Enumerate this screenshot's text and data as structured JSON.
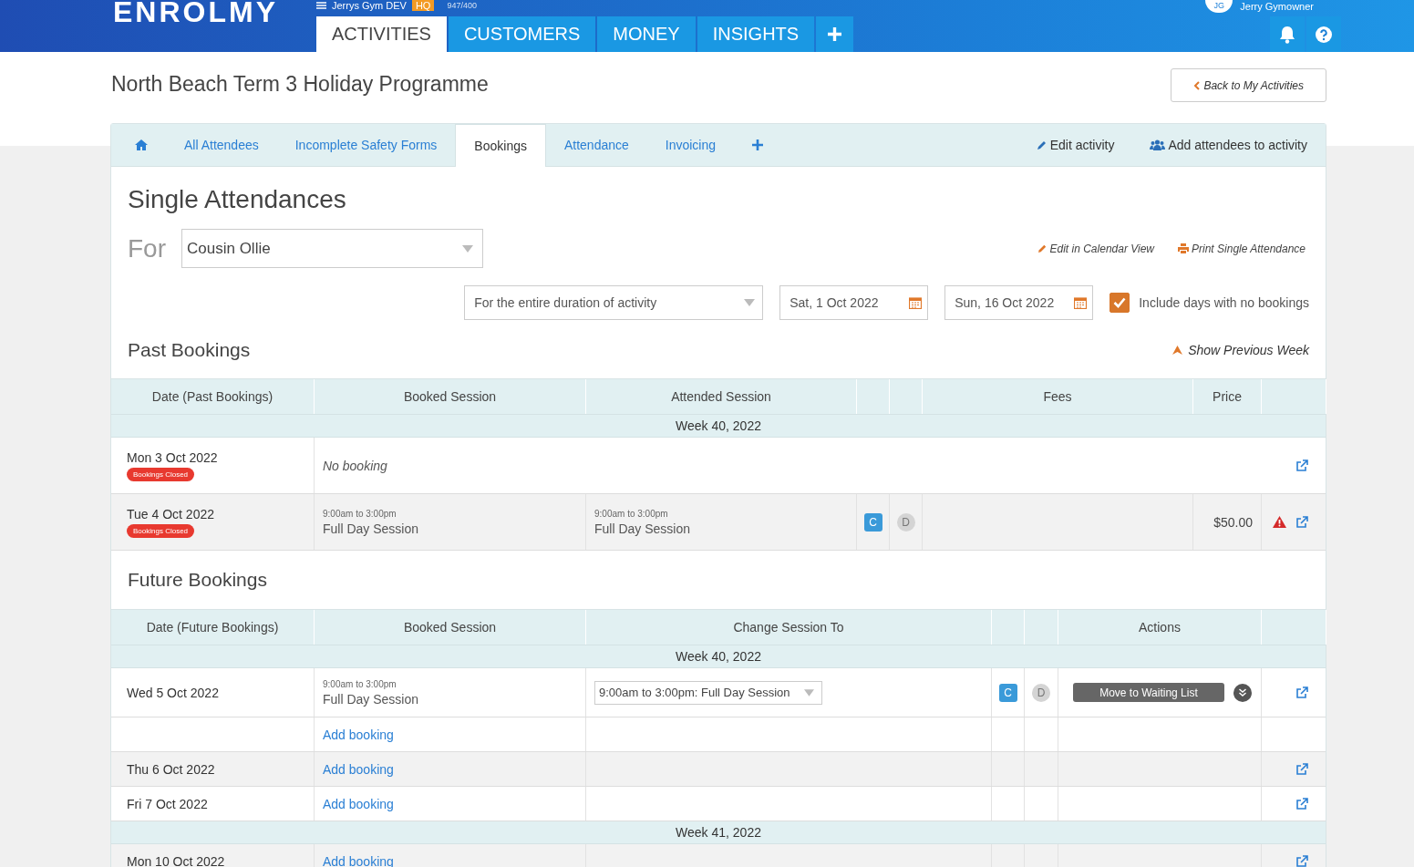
{
  "header": {
    "logo": "ENROLMY",
    "account": "Jerrys Gym DEV",
    "account_badge": "HQ",
    "count": "947/400",
    "user_initials": "JG",
    "user_name": "Jerry Gymowner",
    "nav": [
      {
        "label": "ACTIVITIES",
        "selected": true
      },
      {
        "label": "CUSTOMERS",
        "selected": false
      },
      {
        "label": "MONEY",
        "selected": false
      },
      {
        "label": "INSIGHTS",
        "selected": false
      }
    ]
  },
  "page_title": "North Beach Term 3 Holiday Programme",
  "back_button": "Back to My Activities",
  "tabs": [
    {
      "kind": "home",
      "selected": false
    },
    {
      "kind": "text",
      "label": "All Attendees",
      "selected": false
    },
    {
      "kind": "text",
      "label": "Incomplete Safety Forms",
      "selected": false
    },
    {
      "kind": "text",
      "label": "Bookings",
      "selected": true
    },
    {
      "kind": "text",
      "label": "Attendance",
      "selected": false
    },
    {
      "kind": "text",
      "label": "Invoicing",
      "selected": false
    },
    {
      "kind": "add",
      "selected": false
    }
  ],
  "tab_actions": [
    {
      "kind": "edit",
      "label": "Edit activity"
    },
    {
      "kind": "users",
      "label": "Add attendees to activity"
    }
  ],
  "section_title": "Single Attendances",
  "for_label": "For",
  "attendee_select": "Cousin Ollie",
  "links": [
    {
      "kind": "edit",
      "label": "Edit in Calendar View"
    },
    {
      "kind": "print",
      "label": "Print Single Attendance"
    }
  ],
  "duration_select": "For the entire duration of activity",
  "start_date": "Sat, 1 Oct 2022",
  "end_date": "Sun, 16 Oct 2022",
  "include_empty": {
    "label": "Include days with no bookings",
    "checked": true
  },
  "past": {
    "title": "Past Bookings",
    "toggle": "Show Previous Week",
    "columns": [
      "Date (Past Bookings)",
      "Booked Session",
      "Attended Session",
      "",
      "",
      "Fees",
      "Price",
      ""
    ],
    "rows": [
      {
        "kind": "week",
        "label": "Week 40, 2022"
      },
      {
        "kind": "day",
        "shaded": false,
        "date": "Mon 3 Oct 2022",
        "badge": "Bookings Closed",
        "no_booking": "No booking"
      },
      {
        "kind": "day",
        "shaded": true,
        "date": "Tue 4 Oct 2022",
        "badge": "Bookings Closed",
        "booked": {
          "time": "9:00am to 3:00pm",
          "name": "Full Day Session"
        },
        "attended": {
          "time": "9:00am to 3:00pm",
          "name": "Full Day Session"
        },
        "codes": [
          {
            "label": "C",
            "active": true
          },
          {
            "label": "D",
            "active": false
          }
        ],
        "price": "$50.00",
        "warning": true
      }
    ]
  },
  "future": {
    "title": "Future Bookings",
    "columns": [
      "Date (Future Bookings)",
      "Booked Session",
      "Change Session To",
      "",
      "",
      "Actions",
      ""
    ],
    "rows": [
      {
        "kind": "week",
        "label": "Week 40, 2022"
      },
      {
        "kind": "day",
        "shaded": false,
        "date": "Wed 5 Oct 2022",
        "booked": {
          "time": "9:00am to 3:00pm",
          "name": "Full Day Session"
        },
        "change": "9:00am to 3:00pm: Full Day Session",
        "codes": [
          {
            "label": "C",
            "active": true
          },
          {
            "label": "D",
            "active": false
          }
        ],
        "action": "Move to Waiting List"
      },
      {
        "kind": "day",
        "shaded": false,
        "add": "Add booking"
      },
      {
        "kind": "day",
        "shaded": true,
        "date": "Thu 6 Oct 2022",
        "add": "Add booking"
      },
      {
        "kind": "day",
        "shaded": false,
        "date": "Fri 7 Oct 2022",
        "add": "Add booking"
      },
      {
        "kind": "week",
        "label": "Week 41, 2022"
      },
      {
        "kind": "day",
        "shaded": true,
        "date": "Mon 10 Oct 2022",
        "add": "Add booking"
      }
    ]
  }
}
